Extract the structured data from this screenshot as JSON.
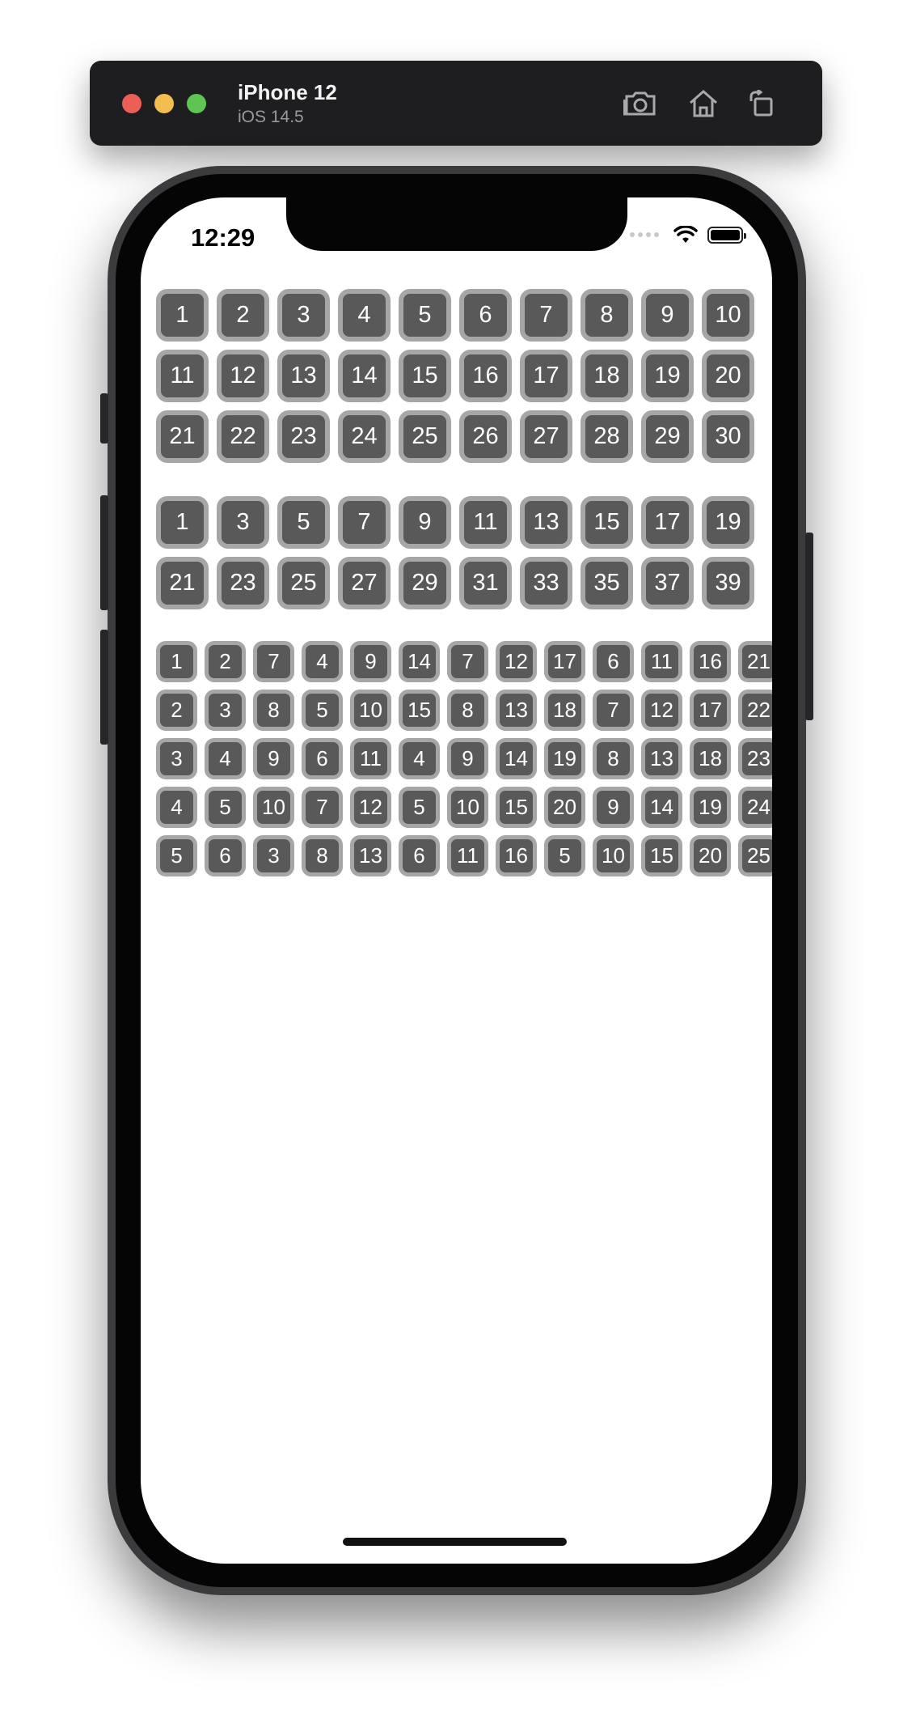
{
  "simulator": {
    "device_name": "iPhone 12",
    "os_version": "iOS 14.5",
    "icons": [
      "screenshot-icon",
      "home-icon",
      "rotate-icon"
    ]
  },
  "status_bar": {
    "time": "12:29",
    "icons": [
      "signal-icon",
      "wifi-icon",
      "battery-icon"
    ]
  },
  "grids": {
    "consecutive": [
      [
        "1",
        "2",
        "3",
        "4",
        "5",
        "6",
        "7",
        "8",
        "9",
        "10"
      ],
      [
        "11",
        "12",
        "13",
        "14",
        "15",
        "16",
        "17",
        "18",
        "19",
        "20"
      ],
      [
        "21",
        "22",
        "23",
        "24",
        "25",
        "26",
        "27",
        "28",
        "29",
        "30"
      ]
    ],
    "odd": [
      [
        "1",
        "3",
        "5",
        "7",
        "9",
        "11",
        "13",
        "15",
        "17",
        "19"
      ],
      [
        "21",
        "23",
        "25",
        "27",
        "29",
        "31",
        "33",
        "35",
        "37",
        "39"
      ]
    ],
    "mixed": [
      [
        "1",
        "2",
        "7",
        "4",
        "9",
        "14",
        "7",
        "12",
        "17",
        "6",
        "11",
        "16",
        "21"
      ],
      [
        "2",
        "3",
        "8",
        "5",
        "10",
        "15",
        "8",
        "13",
        "18",
        "7",
        "12",
        "17",
        "22"
      ],
      [
        "3",
        "4",
        "9",
        "6",
        "11",
        "4",
        "9",
        "14",
        "19",
        "8",
        "13",
        "18",
        "23"
      ],
      [
        "4",
        "5",
        "10",
        "7",
        "12",
        "5",
        "10",
        "15",
        "20",
        "9",
        "14",
        "19",
        "24"
      ],
      [
        "5",
        "6",
        "3",
        "8",
        "13",
        "6",
        "11",
        "16",
        "5",
        "10",
        "15",
        "20",
        "25"
      ]
    ]
  }
}
